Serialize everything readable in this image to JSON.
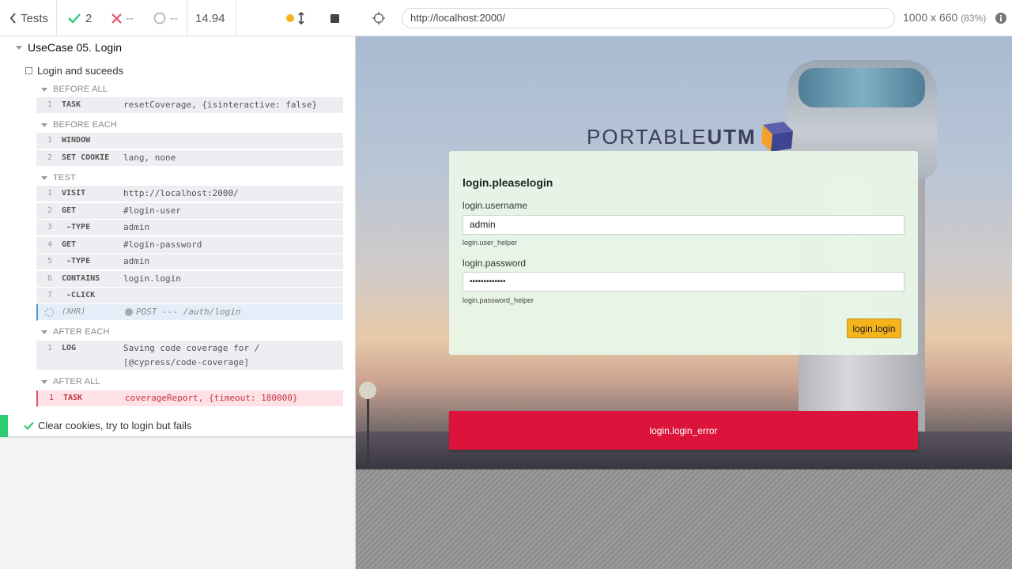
{
  "header": {
    "tests_label": "Tests",
    "passed_count": "2",
    "failed_count": "--",
    "pending_count": "--",
    "duration": "14.94"
  },
  "app_header": {
    "url": "http://localhost:2000/",
    "viewport": "1000 x 660",
    "scale": "(83%)"
  },
  "suite": {
    "title": "UseCase 05. Login",
    "test_title": "Login and suceeds",
    "hooks": [
      {
        "title": "BEFORE ALL"
      },
      {
        "title": "BEFORE EACH"
      },
      {
        "title": "TEST"
      },
      {
        "title": "AFTER EACH"
      },
      {
        "title": "AFTER ALL"
      }
    ],
    "commands": [
      {
        "num": "1",
        "name": "TASK",
        "msg": "resetCoverage, {isinteractive: false}"
      },
      {
        "num": "1",
        "name": "WINDOW",
        "msg": ""
      },
      {
        "num": "2",
        "name": "SET COOKIE",
        "msg": "lang, none"
      },
      {
        "num": "1",
        "name": "VISIT",
        "msg": "http://localhost:2000/"
      },
      {
        "num": "2",
        "name": "GET",
        "msg": "#login-user"
      },
      {
        "num": "3",
        "name": "-TYPE",
        "msg": "admin"
      },
      {
        "num": "4",
        "name": "GET",
        "msg": "#login-password"
      },
      {
        "num": "5",
        "name": "-TYPE",
        "msg": "admin"
      },
      {
        "num": "6",
        "name": "CONTAINS",
        "msg": "login.login"
      },
      {
        "num": "7",
        "name": "-CLICK",
        "msg": ""
      },
      {
        "num": "",
        "name": "(XHR)",
        "msg": "POST --- /auth/login"
      },
      {
        "num": "1",
        "name": "LOG",
        "msg": "Saving code coverage for /",
        "msg2": "[@cypress/code-coverage]"
      },
      {
        "num": "1",
        "name": "TASK",
        "msg": "coverageReport, {timeout: 180000}"
      }
    ],
    "next_test": "Clear cookies, try to login but fails"
  },
  "app": {
    "logo_light": "PORTABLE",
    "logo_bold": "UTM",
    "form_title": "login.pleaselogin",
    "username_label": "login.username",
    "username_value": "admin",
    "username_helper": "login.user_helper",
    "password_label": "login.password",
    "password_value": "•••••••••••••",
    "password_helper": "login.password_helper",
    "login_button": "login.login",
    "error_message": "login.login_error"
  },
  "colors": {
    "passed": "#2ecc71",
    "failed": "#e05565",
    "accent_button": "#f5b41c",
    "error_bar": "#dc143c"
  }
}
